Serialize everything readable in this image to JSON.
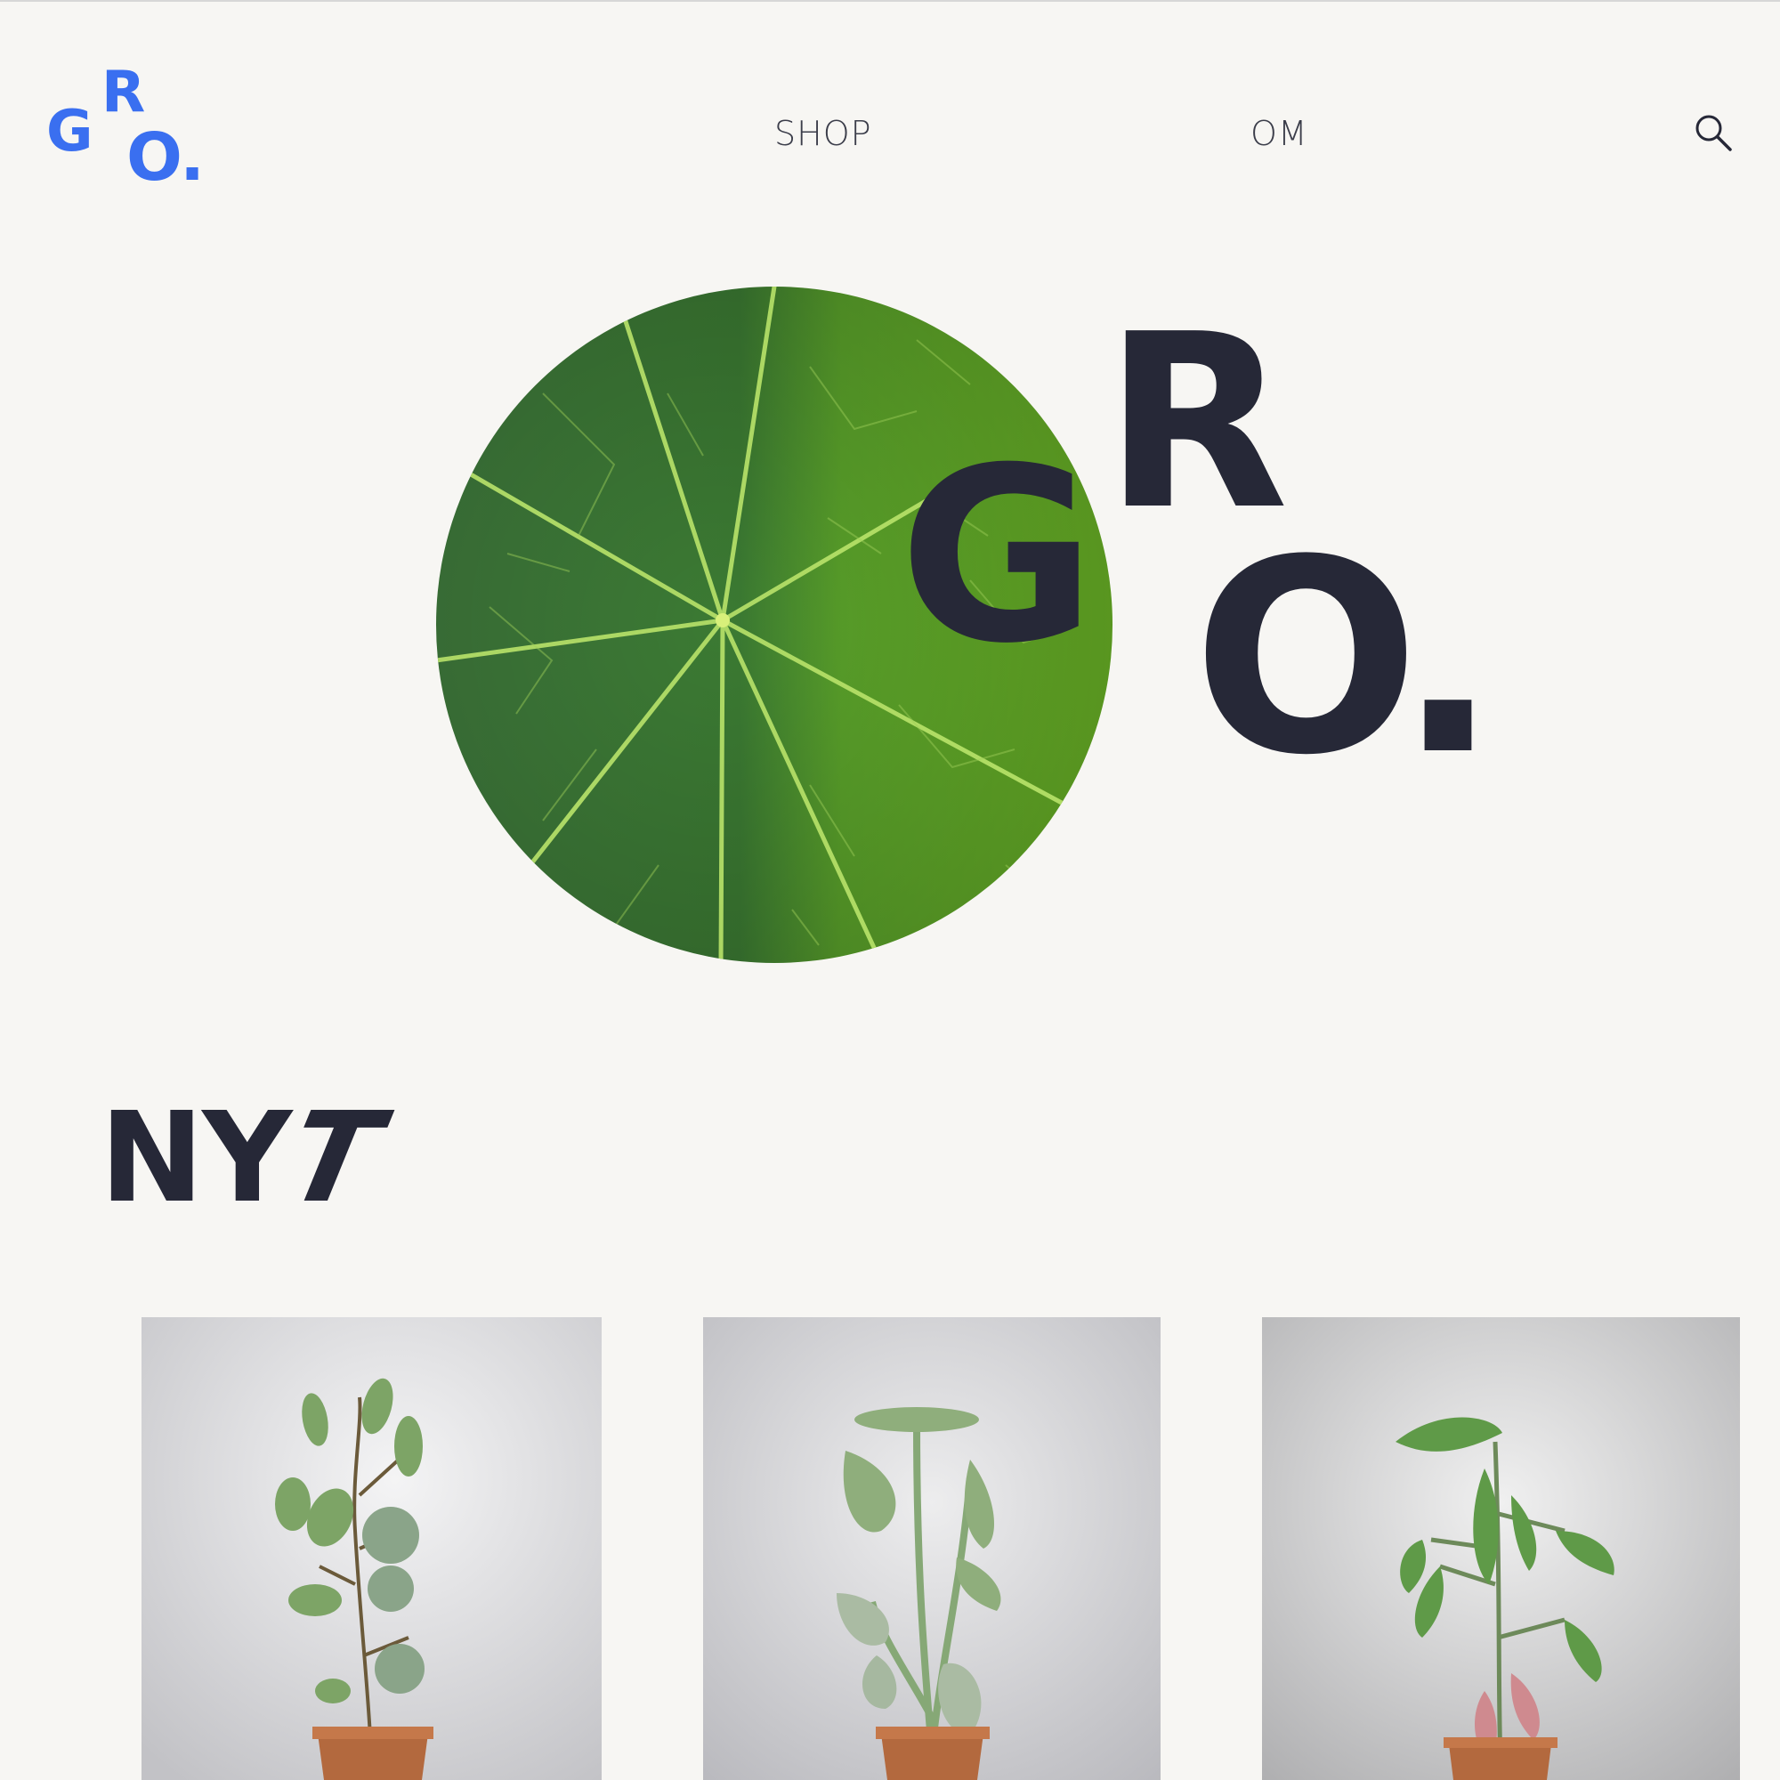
{
  "header": {
    "logo": {
      "letters": [
        "G",
        "R",
        "O",
        "."
      ]
    },
    "nav": [
      {
        "label": "SHOP"
      },
      {
        "label": "OM"
      }
    ],
    "search_icon": "search-icon"
  },
  "hero": {
    "image": "leaf-closeup-image",
    "logo_letters": [
      "G",
      "R",
      "O",
      "."
    ]
  },
  "new_section": {
    "title_main": "NY",
    "title_accent": "T",
    "products": [
      {
        "image": "pilea-plant-image"
      },
      {
        "image": "alocasia-plant-image"
      },
      {
        "image": "philodendron-plant-image"
      }
    ]
  },
  "colors": {
    "background": "#f7f6f3",
    "brand_blue": "#3a6ff0",
    "dark_text": "#262837",
    "leaf_green": "#4b8a3a"
  }
}
